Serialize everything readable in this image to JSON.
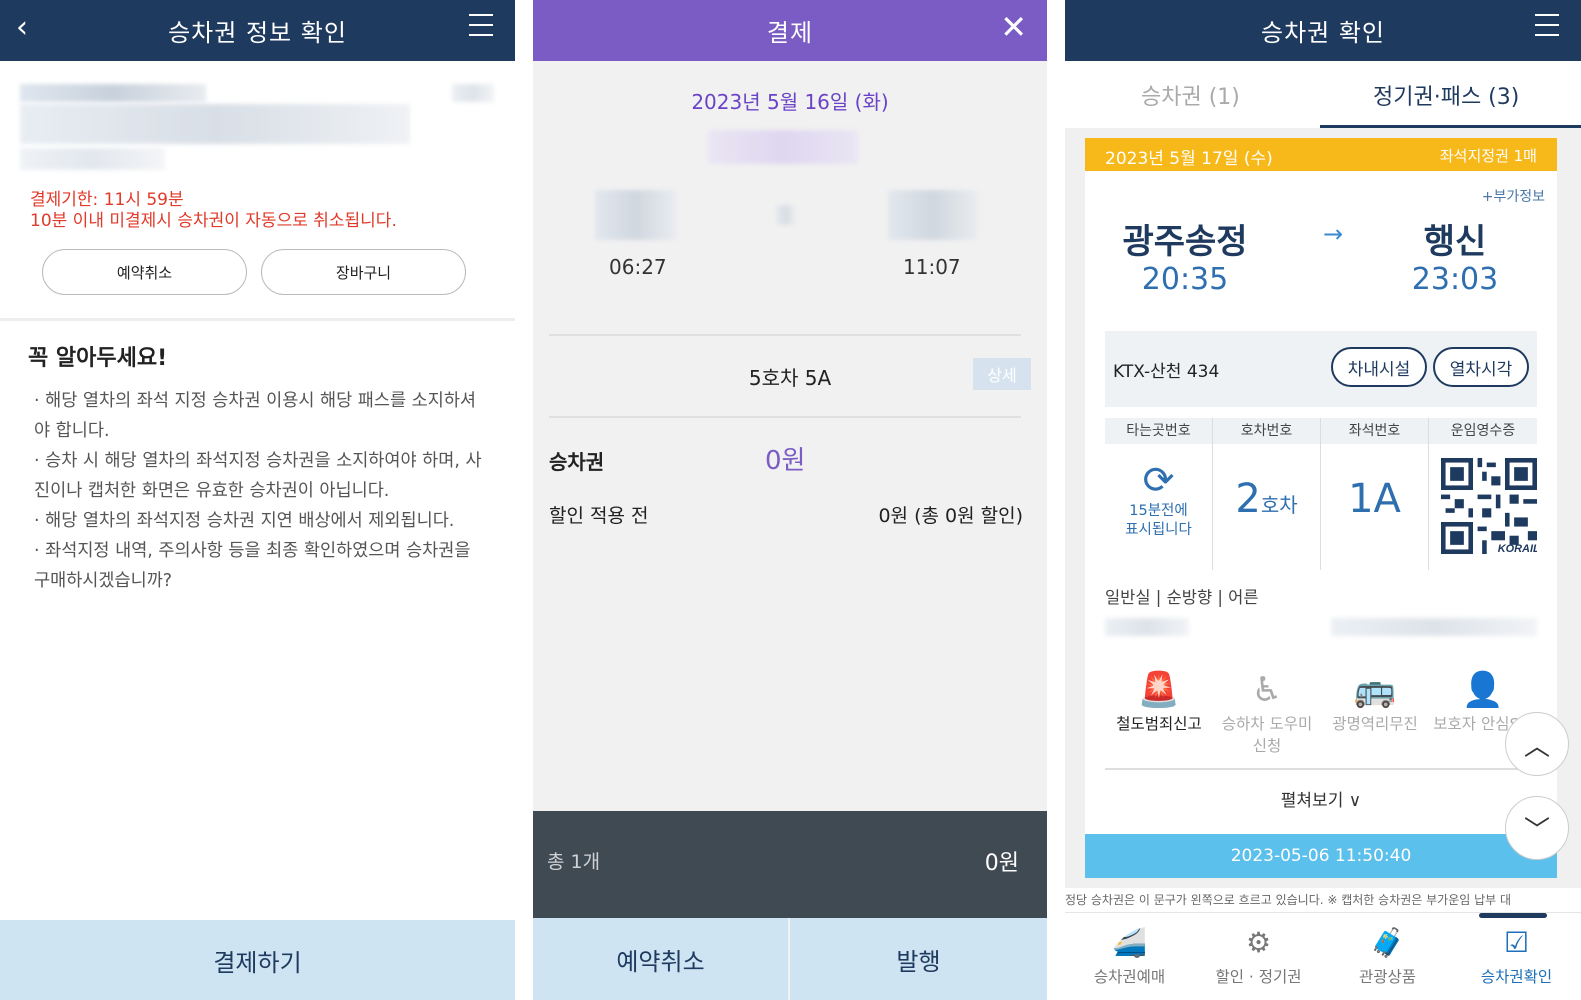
{
  "panel1": {
    "title": "승차권 정보 확인",
    "deadline_line1": "결제기한: 11시 59분",
    "deadline_line2": "10분 이내 미결제시 승차권이 자동으로 취소됩니다.",
    "cancel_btn": "예약취소",
    "cart_btn": "장바구니",
    "notice_title": "꼭 알아두세요!",
    "notices": [
      "· 해당 열차의 좌석 지정 승차권 이용시 해당 패스를 소지하셔야 합니다.",
      "· 승차 시 해당 열차의 좌석지정 승차권을 소지하여야 하며, 사진이나 캡처한 화면은 유효한 승차권이 아닙니다.",
      "· 해당 열차의 좌석지정 승차권 지연 배상에서 제외됩니다.",
      "· 좌석지정 내역, 주의사항 등을 최종 확인하였으며 승차권을 구매하시겠습니까?"
    ],
    "pay_btn": "결제하기"
  },
  "panel2": {
    "title": "결제",
    "date": "2023년 5월 16일 (화)",
    "dep_time": "06:27",
    "arr_time": "11:07",
    "seat": "5호차 5A",
    "detail_btn": "상세",
    "ticket_label": "승차권",
    "ticket_price": "0원",
    "before_discount_label": "할인 적용 전",
    "before_discount_value": "0원 (총 0원 할인)",
    "total_count": "총 1개",
    "total_price": "0원",
    "cancel_btn": "예약취소",
    "issue_btn": "발행"
  },
  "panel3": {
    "title": "승차권 확인",
    "tab1": "승차권 (1)",
    "tab2": "정기권·패스 (3)",
    "card_date": "2023년 5월 17일 (수)",
    "card_type": "좌석지정권 1매",
    "extra_info": "+부가정보",
    "from_station": "광주송정",
    "to_station": "행신",
    "dep_time": "20:35",
    "arr_time": "23:03",
    "train_name": "KTX-산천 434",
    "facility_btn": "차내시설",
    "schedule_btn": "열차시각",
    "col_headers": [
      "타는곳번호",
      "호차번호",
      "좌석번호",
      "운임영수증"
    ],
    "platform_line1": "15분전에",
    "platform_line2": "표시됩니다",
    "car_no": "2",
    "car_suffix": "호차",
    "seat_no": "1A",
    "qr_label": "KORAIL",
    "seat_info": "일반실 | 순방향 | 어른",
    "services": [
      {
        "label": "철도범죄신고",
        "icon": "siren-icon"
      },
      {
        "label": "승하차 도우미 신청",
        "icon": "wheelchair-icon"
      },
      {
        "label": "광명역리무진",
        "icon": "bus-icon"
      },
      {
        "label": "보호자 안심SM",
        "icon": "guardian-icon"
      }
    ],
    "expand": "펼쳐보기 ∨",
    "timestamp": "2023-05-06 11:50:40",
    "marquee": "정당 승차권은 이 문구가 왼쪽으로 흐르고 있습니다. ※ 캡처한 승차권은 부가운임 납부 대",
    "nav": [
      {
        "label": "승차권예매",
        "icon": "ktx-train-icon"
      },
      {
        "label": "할인 · 정기권",
        "icon": "discount-icon"
      },
      {
        "label": "관광상품",
        "icon": "luggage-icon"
      },
      {
        "label": "승차권확인",
        "icon": "ticket-check-icon"
      }
    ]
  },
  "colors": {
    "navy": "#1f3a5f",
    "purple": "#7b5cc4",
    "alert_red": "#e03a2a",
    "ticket_yellow": "#f7b91a",
    "timestamp_blue": "#5cc0ec"
  }
}
